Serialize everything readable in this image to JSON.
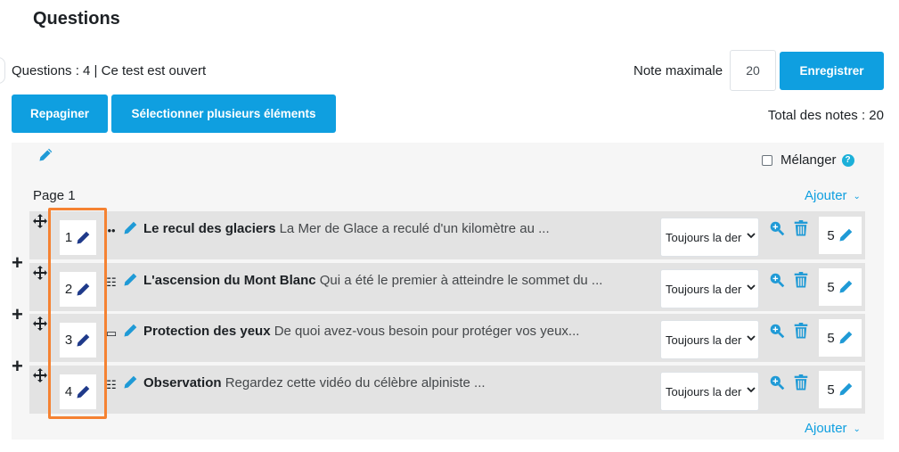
{
  "header": {
    "title": "Questions"
  },
  "summary": {
    "info": "Questions : 4 | Ce test est ouvert",
    "total": "Total des notes : 20"
  },
  "max_grade": {
    "label": "Note maximale",
    "value": "20",
    "save_label": "Enregistrer"
  },
  "toolbar": {
    "repaginate_label": "Repaginer",
    "multi_select_label": "Sélectionner plusieurs éléments"
  },
  "section": {
    "shuffle_label": "Mélanger",
    "help_glyph": "?",
    "page_label": "Page 1",
    "add_label": "Ajouter",
    "add_chevron": "⌄"
  },
  "questions": [
    {
      "number": "1",
      "type_glyph": "••",
      "name": "Le recul des glaciers",
      "preview": "La Mer de Glace a reculé d'un kilomètre au ...",
      "behaviour": "Toujours la der",
      "mark": "5"
    },
    {
      "number": "2",
      "type_glyph": "☷",
      "name": "L'ascension du Mont Blanc",
      "preview": "Qui a été le premier à atteindre le sommet du ...",
      "behaviour": "Toujours la der",
      "mark": "5"
    },
    {
      "number": "3",
      "type_glyph": "▭",
      "name": "Protection des yeux",
      "preview": "De quoi avez-vous besoin pour protéger vos yeux...",
      "behaviour": "Toujours la der",
      "mark": "5"
    },
    {
      "number": "4",
      "type_glyph": "☷",
      "name": "Observation",
      "preview": "Regardez cette vidéo du célèbre alpiniste ...",
      "behaviour": "Toujours la der",
      "mark": "5"
    }
  ],
  "add_question_glyph": "+",
  "colors": {
    "accent": "#0f9fe0",
    "highlight": "#f58232",
    "pencil": "#1f3a8a",
    "row_bg": "#e3e3e3",
    "panel_bg": "#f6f6f6"
  }
}
